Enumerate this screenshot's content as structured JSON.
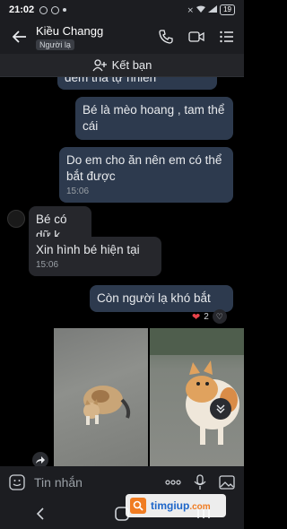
{
  "status_bar": {
    "time": "21:02",
    "battery": "19"
  },
  "header": {
    "contact_name": "Kiều Changg",
    "badge": "Người lạ"
  },
  "add_friend": {
    "label": "Kết bạn"
  },
  "messages": [
    {
      "sender": "me",
      "text": "dem tha tự nhiên"
    },
    {
      "sender": "me",
      "text": "Bé là mèo hoang , tam thể cái"
    },
    {
      "sender": "me",
      "text": "Do em cho ăn nên em có thể bắt được",
      "time": "15:06"
    },
    {
      "sender": "them",
      "text": "Bé có dữ k"
    },
    {
      "sender": "them",
      "text": "Xin hình bé hiện tại",
      "time": "15:06"
    },
    {
      "sender": "me",
      "text": "Còn người lạ khó bắt",
      "reaction_count": "2"
    }
  ],
  "composer": {
    "placeholder": "Tin nhắn"
  },
  "watermark": {
    "brand": "timgiup",
    "domain": ".com"
  }
}
